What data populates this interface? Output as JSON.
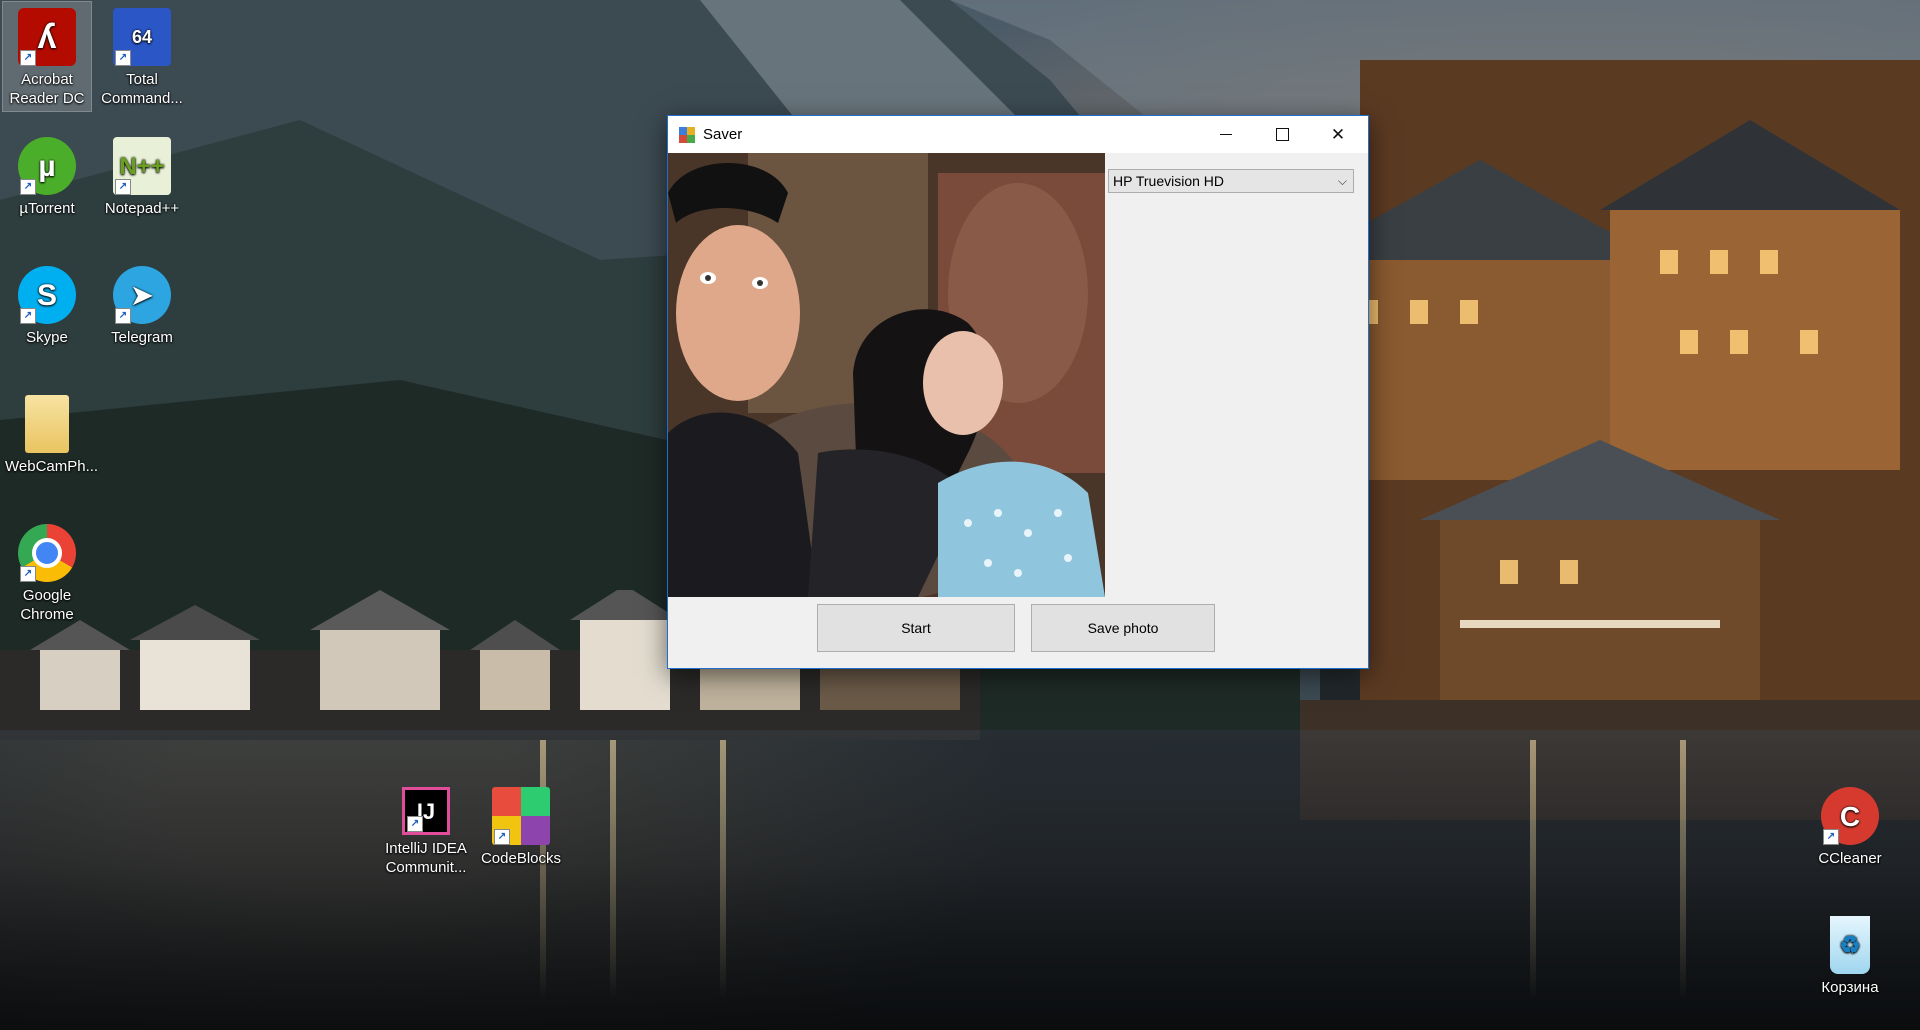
{
  "desktop": {
    "icons": [
      {
        "label": "Acrobat Reader DC",
        "icon": "acrobat-icon",
        "color": "#b30b00"
      },
      {
        "label": "Total Command...",
        "icon": "floppy-disk-icon",
        "color": "#2a56c6"
      },
      {
        "label": "µTorrent",
        "icon": "utorrent-icon",
        "color": "#4bae2b"
      },
      {
        "label": "Notepad++",
        "icon": "notepad-plus-plus-icon",
        "color": "#8cc63f"
      },
      {
        "label": "Skype",
        "icon": "skype-icon",
        "color": "#00aff0"
      },
      {
        "label": "Telegram",
        "icon": "telegram-icon",
        "color": "#2ca5e0"
      },
      {
        "label": "WebCamPh...",
        "icon": "folder-icon",
        "color": "#f3d27a"
      },
      {
        "label": "Google Chrome",
        "icon": "chrome-icon",
        "color": "#4285f4"
      },
      {
        "label": "IntelliJ IDEA Communit...",
        "icon": "intellij-icon",
        "color": "#000000"
      },
      {
        "label": "CodeBlocks",
        "icon": "codeblocks-icon",
        "color": "#c0392b"
      },
      {
        "label": "CCleaner",
        "icon": "ccleaner-icon",
        "color": "#d63a2f"
      },
      {
        "label": "Корзина",
        "icon": "recycle-bin-icon",
        "color": "#8fd3f4"
      }
    ]
  },
  "window": {
    "title": "Saver",
    "accent": "#1f6fce",
    "camera_select": {
      "selected": "HP Truevision HD"
    },
    "buttons": {
      "start": "Start",
      "save_photo": "Save photo"
    }
  }
}
